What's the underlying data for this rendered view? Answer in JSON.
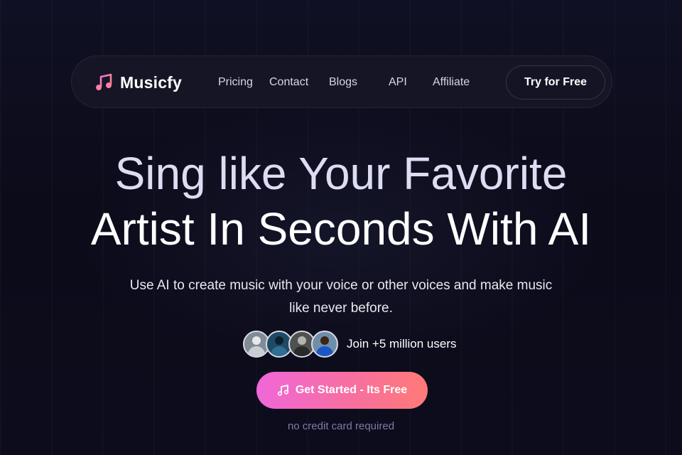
{
  "brand": {
    "name": "Musicfy",
    "icon": "music-note-icon"
  },
  "nav": {
    "links": [
      "Pricing",
      "Contact",
      "Blogs",
      "API",
      "Affiliate"
    ],
    "cta_label": "Try for Free"
  },
  "hero": {
    "title_line1": "Sing like Your Favorite",
    "title_line2": "Artist In Seconds With AI",
    "subtitle": "Use AI to create music with your voice or other voices and make music like never before."
  },
  "social_proof": {
    "text": "Join +5 million users",
    "avatar_count": 4
  },
  "cta": {
    "label": "Get Started - Its Free",
    "icon": "music-note-icon",
    "note": "no credit card required"
  },
  "colors": {
    "background": "#0b0b1a",
    "cta_gradient_start": "#f067d8",
    "cta_gradient_end": "#ff7a76",
    "footnote": "#7c7ca8"
  }
}
